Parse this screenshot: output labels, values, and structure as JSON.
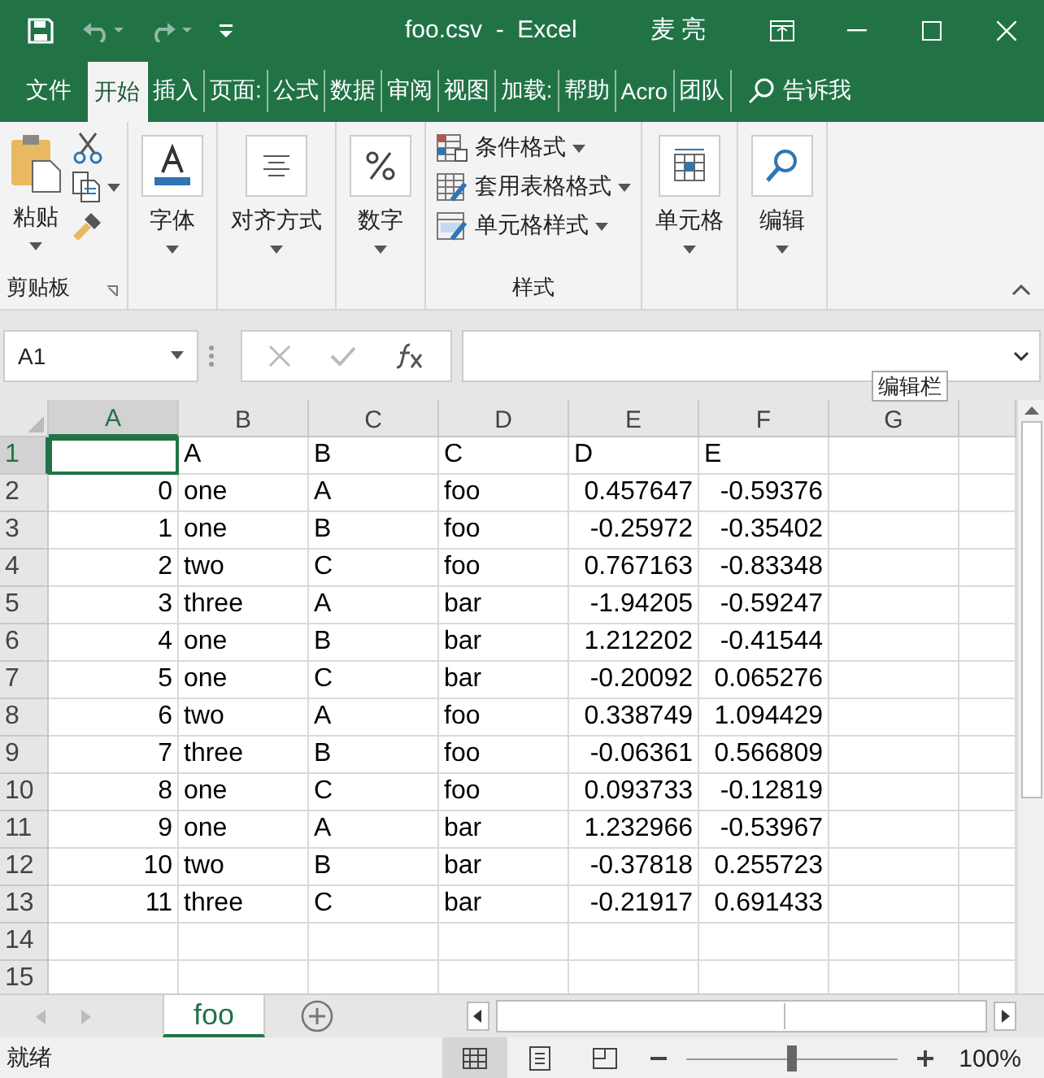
{
  "window": {
    "title": "foo.csv  -  Excel",
    "user": "麦 亮"
  },
  "ribbon_tabs": [
    {
      "label": "文件",
      "selected": false
    },
    {
      "label": "开始",
      "selected": true
    },
    {
      "label": "插入",
      "selected": false
    },
    {
      "label": "页面:",
      "selected": false
    },
    {
      "label": "公式",
      "selected": false
    },
    {
      "label": "数据",
      "selected": false
    },
    {
      "label": "审阅",
      "selected": false
    },
    {
      "label": "视图",
      "selected": false
    },
    {
      "label": "加载:",
      "selected": false
    },
    {
      "label": "帮助",
      "selected": false
    },
    {
      "label": "Acro",
      "selected": false
    },
    {
      "label": "团队",
      "selected": false
    }
  ],
  "tell_me": "告诉我",
  "ribbon": {
    "clipboard": {
      "paste": "粘贴",
      "label": "剪贴板"
    },
    "big_buttons": [
      {
        "label": "字体",
        "kind": "font"
      },
      {
        "label": "对齐方式",
        "kind": "align"
      },
      {
        "label": "数字",
        "kind": "number"
      }
    ],
    "styles": {
      "items": [
        {
          "label": "条件格式",
          "kind": "conditional"
        },
        {
          "label": "套用表格格式",
          "kind": "table"
        },
        {
          "label": "单元格样式",
          "kind": "cell"
        }
      ],
      "label": "样式"
    },
    "tail_buttons": [
      {
        "label": "单元格",
        "kind": "cells"
      },
      {
        "label": "编辑",
        "kind": "edit"
      }
    ]
  },
  "formula_bar": {
    "name_box": "A1",
    "tooltip": "编辑栏"
  },
  "sheet": {
    "columns": [
      {
        "label": "A",
        "kind": "number",
        "selected": true
      },
      {
        "label": "B",
        "kind": "text",
        "selected": false
      },
      {
        "label": "C",
        "kind": "text",
        "selected": false
      },
      {
        "label": "D",
        "kind": "text",
        "selected": false
      },
      {
        "label": "E",
        "kind": "number",
        "selected": false
      },
      {
        "label": "F",
        "kind": "number",
        "selected": false
      },
      {
        "label": "G",
        "kind": "text",
        "selected": false
      }
    ],
    "rows": [
      {
        "header": "1",
        "kind": "header",
        "selected": true,
        "cells": [
          "",
          "A",
          "B",
          "C",
          "D",
          "E"
        ]
      },
      {
        "header": "2",
        "kind": "data",
        "selected": false,
        "cells": [
          "0",
          "one",
          "A",
          "foo",
          "0.457647",
          "-0.59376"
        ]
      },
      {
        "header": "3",
        "kind": "data",
        "selected": false,
        "cells": [
          "1",
          "one",
          "B",
          "foo",
          "-0.25972",
          "-0.35402"
        ]
      },
      {
        "header": "4",
        "kind": "data",
        "selected": false,
        "cells": [
          "2",
          "two",
          "C",
          "foo",
          "0.767163",
          "-0.83348"
        ]
      },
      {
        "header": "5",
        "kind": "data",
        "selected": false,
        "cells": [
          "3",
          "three",
          "A",
          "bar",
          "-1.94205",
          "-0.59247"
        ]
      },
      {
        "header": "6",
        "kind": "data",
        "selected": false,
        "cells": [
          "4",
          "one",
          "B",
          "bar",
          "1.212202",
          "-0.41544"
        ]
      },
      {
        "header": "7",
        "kind": "data",
        "selected": false,
        "cells": [
          "5",
          "one",
          "C",
          "bar",
          "-0.20092",
          "0.065276"
        ]
      },
      {
        "header": "8",
        "kind": "data",
        "selected": false,
        "cells": [
          "6",
          "two",
          "A",
          "foo",
          "0.338749",
          "1.094429"
        ]
      },
      {
        "header": "9",
        "kind": "data",
        "selected": false,
        "cells": [
          "7",
          "three",
          "B",
          "foo",
          "-0.06361",
          "0.566809"
        ]
      },
      {
        "header": "10",
        "kind": "data",
        "selected": false,
        "cells": [
          "8",
          "one",
          "C",
          "foo",
          "0.093733",
          "-0.12819"
        ]
      },
      {
        "header": "11",
        "kind": "data",
        "selected": false,
        "cells": [
          "9",
          "one",
          "A",
          "bar",
          "1.232966",
          "-0.53967"
        ]
      },
      {
        "header": "12",
        "kind": "data",
        "selected": false,
        "cells": [
          "10",
          "two",
          "B",
          "bar",
          "-0.37818",
          "0.255723"
        ]
      },
      {
        "header": "13",
        "kind": "data",
        "selected": false,
        "cells": [
          "11",
          "three",
          "C",
          "bar",
          "-0.21917",
          "0.691433"
        ]
      },
      {
        "header": "14",
        "kind": "data",
        "selected": false,
        "cells": []
      },
      {
        "header": "15",
        "kind": "data",
        "selected": false,
        "cells": []
      }
    ]
  },
  "sheet_tabs": [
    {
      "label": "foo",
      "selected": true
    }
  ],
  "status_bar": {
    "status": "就绪",
    "views": [
      {
        "kind": "normal",
        "selected": true
      },
      {
        "kind": "page",
        "selected": false
      },
      {
        "kind": "break",
        "selected": false
      }
    ],
    "zoom": {
      "level": 0.5,
      "reading": "100%"
    }
  }
}
